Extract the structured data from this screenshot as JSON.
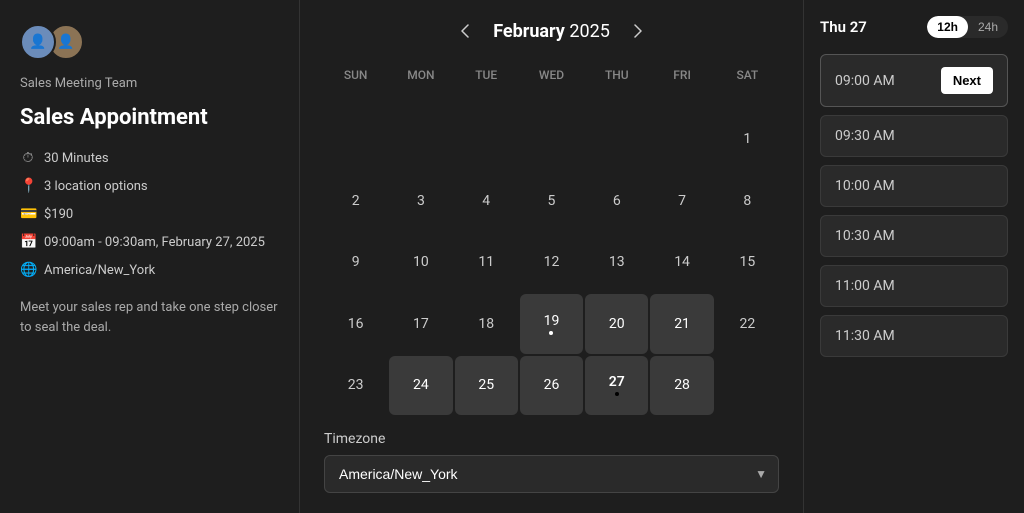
{
  "left": {
    "team_name": "Sales Meeting Team",
    "event_title": "Sales Appointment",
    "duration": "30 Minutes",
    "location": "3 location options",
    "price": "$190",
    "time_range": "09:00am - 09:30am, February 27, 2025",
    "timezone": "America/New_York",
    "description": "Meet your sales rep and take one step closer to seal the deal."
  },
  "calendar": {
    "month": "February",
    "year": "2025",
    "weekdays": [
      "SUN",
      "MON",
      "TUE",
      "WED",
      "THU",
      "FRI",
      "SAT"
    ],
    "prev_label": "‹",
    "next_label": "›",
    "weeks": [
      [
        null,
        null,
        null,
        null,
        null,
        null,
        1
      ],
      [
        2,
        3,
        4,
        5,
        6,
        7,
        8
      ],
      [
        9,
        10,
        11,
        12,
        13,
        14,
        15
      ],
      [
        16,
        17,
        18,
        19,
        20,
        21,
        22
      ],
      [
        23,
        24,
        25,
        26,
        27,
        28,
        null
      ]
    ],
    "selected_day": 27,
    "highlighted_days": [
      19,
      20,
      21,
      24,
      25,
      26,
      27,
      28
    ],
    "dot_days": [
      19,
      27
    ]
  },
  "timezone_section": {
    "label": "Timezone",
    "value": "America/New_York"
  },
  "right": {
    "date_label": "Thu 27",
    "format_12h": "12h",
    "format_24h": "24h",
    "active_format": "12h",
    "time_slots": [
      {
        "time": "09:00 AM",
        "selected": true
      },
      {
        "time": "09:30 AM",
        "selected": false
      },
      {
        "time": "10:00 AM",
        "selected": false
      },
      {
        "time": "10:30 AM",
        "selected": false
      },
      {
        "time": "11:00 AM",
        "selected": false
      },
      {
        "time": "11:30 AM",
        "selected": false
      }
    ],
    "next_label": "Next"
  }
}
